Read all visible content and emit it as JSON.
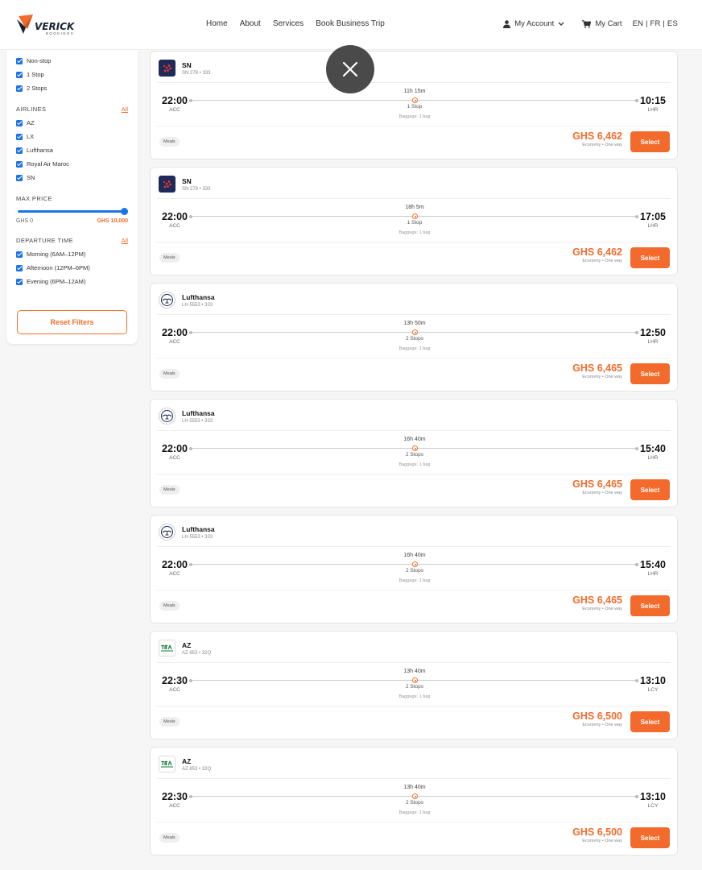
{
  "header": {
    "logo_main": "VERICK",
    "logo_sub": "BOOKINGS",
    "nav": [
      "Home",
      "About",
      "Services",
      "Book Business Trip"
    ],
    "account_label": "My Account",
    "cart_label": "My Cart",
    "languages": "EN | FR | ES"
  },
  "filters": {
    "stops": [
      "Non-stop",
      "1 Stop",
      "2 Stops"
    ],
    "airlines_title": "AIRLINES",
    "airlines_all": "All",
    "airlines": [
      "AZ",
      "LX",
      "Lufthansa",
      "Royal Air Maroc",
      "SN"
    ],
    "max_price_title": "MAX PRICE",
    "price_min": "GHS 0",
    "price_max": "GHS 10,000",
    "price_level": 1.0,
    "departure_title": "DEPARTURE TIME",
    "departure_all": "All",
    "departure_times": [
      "Morning (6AM–12PM)",
      "Afternoon (12PM–6PM)",
      "Evening (6PM–12AM)"
    ],
    "reset_label": "Reset Filters"
  },
  "flights": [
    {
      "airline": "SN",
      "logo": "sn-logo",
      "flight_no": "SN 278 • 333",
      "dep_time": "22:00",
      "dep_code": "ACC",
      "arr_time": "10:15",
      "arr_code": "LHR",
      "duration": "11h 15m",
      "stops": "1 Stop",
      "baggage": "Baggage: 1 bag",
      "meals": "Meals",
      "price": "GHS 6,462",
      "cabin": "Economy • One way",
      "select": "Select"
    },
    {
      "airline": "SN",
      "logo": "sn-logo",
      "flight_no": "SN 278 • 333",
      "dep_time": "22:00",
      "dep_code": "ACC",
      "arr_time": "17:05",
      "arr_code": "LHR",
      "duration": "18h 5m",
      "stops": "1 Stop",
      "baggage": "Baggage: 1 bag",
      "meals": "Meals",
      "price": "GHS 6,462",
      "cabin": "Economy • One way",
      "select": "Select"
    },
    {
      "airline": "Lufthansa",
      "logo": "lufthansa-logo",
      "flight_no": "LH 5553 • 333",
      "dep_time": "22:00",
      "dep_code": "ACC",
      "arr_time": "12:50",
      "arr_code": "LHR",
      "duration": "13h 50m",
      "stops": "2 Stops",
      "baggage": "Baggage: 1 bag",
      "meals": "Meals",
      "price": "GHS 6,465",
      "cabin": "Economy • One way",
      "select": "Select"
    },
    {
      "airline": "Lufthansa",
      "logo": "lufthansa-logo",
      "flight_no": "LH 5553 • 333",
      "dep_time": "22:00",
      "dep_code": "ACC",
      "arr_time": "15:40",
      "arr_code": "LHR",
      "duration": "16h 40m",
      "stops": "2 Stops",
      "baggage": "Baggage: 1 bag",
      "meals": "Meals",
      "price": "GHS 6,465",
      "cabin": "Economy • One way",
      "select": "Select"
    },
    {
      "airline": "Lufthansa",
      "logo": "lufthansa-logo",
      "flight_no": "LH 5553 • 333",
      "dep_time": "22:00",
      "dep_code": "ACC",
      "arr_time": "15:40",
      "arr_code": "LHR",
      "duration": "16h 40m",
      "stops": "2 Stops",
      "baggage": "Baggage: 1 bag",
      "meals": "Meals",
      "price": "GHS 6,465",
      "cabin": "Economy • One way",
      "select": "Select"
    },
    {
      "airline": "AZ",
      "logo": "ita-airways-logo",
      "flight_no": "AZ 853 • 32Q",
      "dep_time": "22:30",
      "dep_code": "ACC",
      "arr_time": "13:10",
      "arr_code": "LCY",
      "duration": "13h 40m",
      "stops": "2 Stops",
      "baggage": "Baggage: 1 bag",
      "meals": "Meals",
      "price": "GHS 6,500",
      "cabin": "Economy • One way",
      "select": "Select"
    },
    {
      "airline": "AZ",
      "logo": "ita-airways-logo",
      "flight_no": "AZ 853 • 32Q",
      "dep_time": "22:30",
      "dep_code": "ACC",
      "arr_time": "13:10",
      "arr_code": "LCY",
      "duration": "13h 40m",
      "stops": "2 Stops",
      "baggage": "Baggage: 1 bag",
      "meals": "Meals",
      "price": "GHS 6,500",
      "cabin": "Economy • One way",
      "select": "Select"
    }
  ],
  "colors": {
    "accent": "#f26b2c",
    "checkbox": "#1a73e8",
    "overlay": "#4a4a4a"
  }
}
